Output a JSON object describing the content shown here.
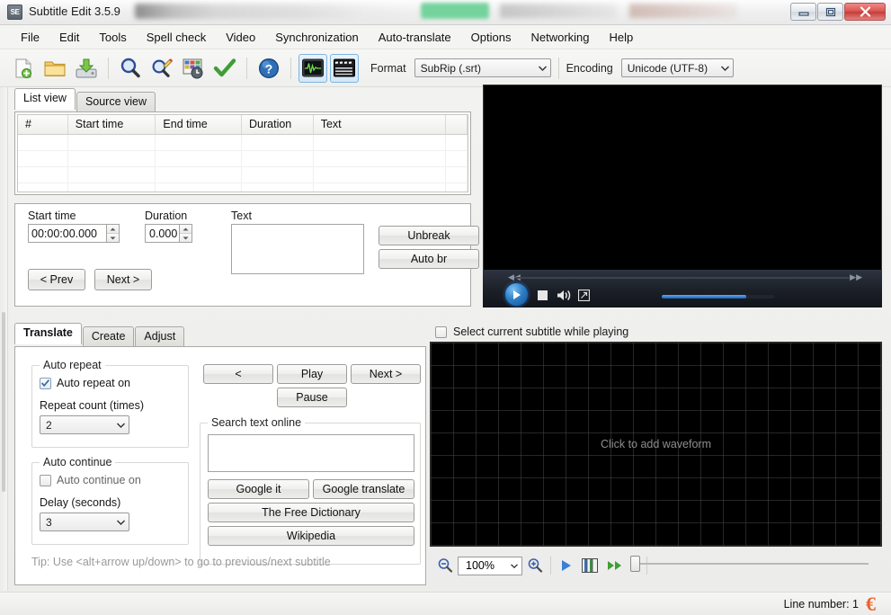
{
  "window": {
    "title": "Subtitle Edit 3.5.9",
    "icon_label": "SE",
    "minimize_label": "Minimize",
    "maximize_label": "Maximize",
    "close_label": "Close"
  },
  "menu": {
    "items": [
      {
        "label": "File"
      },
      {
        "label": "Edit"
      },
      {
        "label": "Tools"
      },
      {
        "label": "Spell check"
      },
      {
        "label": "Video"
      },
      {
        "label": "Synchronization"
      },
      {
        "label": "Auto-translate"
      },
      {
        "label": "Options"
      },
      {
        "label": "Networking"
      },
      {
        "label": "Help"
      }
    ]
  },
  "toolbar": {
    "buttons": [
      {
        "name": "new-file-icon",
        "title": "New"
      },
      {
        "name": "open-folder-icon",
        "title": "Open"
      },
      {
        "name": "save-icon",
        "title": "Save"
      },
      {
        "name": "find-icon",
        "title": "Find"
      },
      {
        "name": "replace-icon",
        "title": "Replace"
      },
      {
        "name": "fix-common-errors-icon",
        "title": "Fix common errors"
      },
      {
        "name": "spell-check-icon",
        "title": "Spell check"
      },
      {
        "name": "help-icon",
        "title": "Help"
      },
      {
        "name": "waveform-toggle-icon",
        "title": "Toggle waveform"
      },
      {
        "name": "video-toggle-icon",
        "title": "Toggle video"
      }
    ],
    "format_label": "Format",
    "format_value": "SubRip (.srt)",
    "encoding_label": "Encoding",
    "encoding_value": "Unicode (UTF-8)"
  },
  "list_area": {
    "tabs": [
      {
        "label": "List view",
        "active": true
      },
      {
        "label": "Source view",
        "active": false
      }
    ],
    "columns": [
      {
        "label": "#",
        "width": 56
      },
      {
        "label": "Start time",
        "width": 98
      },
      {
        "label": "End time",
        "width": 96
      },
      {
        "label": "Duration",
        "width": 80
      },
      {
        "label": "Text",
        "width": 148
      },
      {
        "label": "",
        "width": 22
      }
    ],
    "rows": []
  },
  "editor": {
    "start_time_label": "Start time",
    "start_time_value": "00:00:00.000",
    "duration_label": "Duration",
    "duration_value": "0.000",
    "text_label": "Text",
    "text_value": "",
    "unbreak_label": "Unbreak",
    "auto_br_label": "Auto br",
    "prev_label": "< Prev",
    "next_label": "Next >"
  },
  "bottom": {
    "tabs": [
      {
        "label": "Translate",
        "active": true
      },
      {
        "label": "Create",
        "active": false
      },
      {
        "label": "Adjust",
        "active": false
      }
    ],
    "auto_repeat": {
      "group_label": "Auto repeat",
      "checkbox_label": "Auto repeat on",
      "checked": true,
      "count_label": "Repeat count (times)",
      "count_value": "2"
    },
    "auto_continue": {
      "group_label": "Auto continue",
      "checkbox_label": "Auto continue on",
      "checked": false,
      "delay_label": "Delay (seconds)",
      "delay_value": "3"
    },
    "playback": {
      "back_label": "<",
      "play_label": "Play",
      "next_label": "Next >",
      "pause_label": "Pause"
    },
    "search_online": {
      "group_label": "Search text online",
      "input_value": "",
      "google_it_label": "Google it",
      "google_translate_label": "Google translate",
      "free_dictionary_label": "The Free Dictionary",
      "wikipedia_label": "Wikipedia"
    },
    "tip": "Tip: Use <alt+arrow up/down> to go to previous/next subtitle"
  },
  "video": {
    "select_subtitle_label": "Select current subtitle while playing",
    "select_subtitle_checked": false,
    "play_title": "Play",
    "stop_title": "Stop",
    "mute_title": "Mute",
    "fullscreen_title": "Fullscreen"
  },
  "waveform": {
    "placeholder": "Click to add waveform",
    "zoom_value": "100%",
    "zoom_out_title": "Zoom out",
    "zoom_in_title": "Zoom in",
    "play_title": "Play",
    "grid_title": "Show grid",
    "forward_title": "Forward"
  },
  "status": {
    "line_number": "Line number: 1"
  },
  "colors": {
    "accent_blue": "#2f7fc8",
    "close_red": "#d9544f",
    "toggle_border": "#7fb4e0",
    "logo_orange": "#e8622a",
    "badge_green": "#74d39c"
  }
}
